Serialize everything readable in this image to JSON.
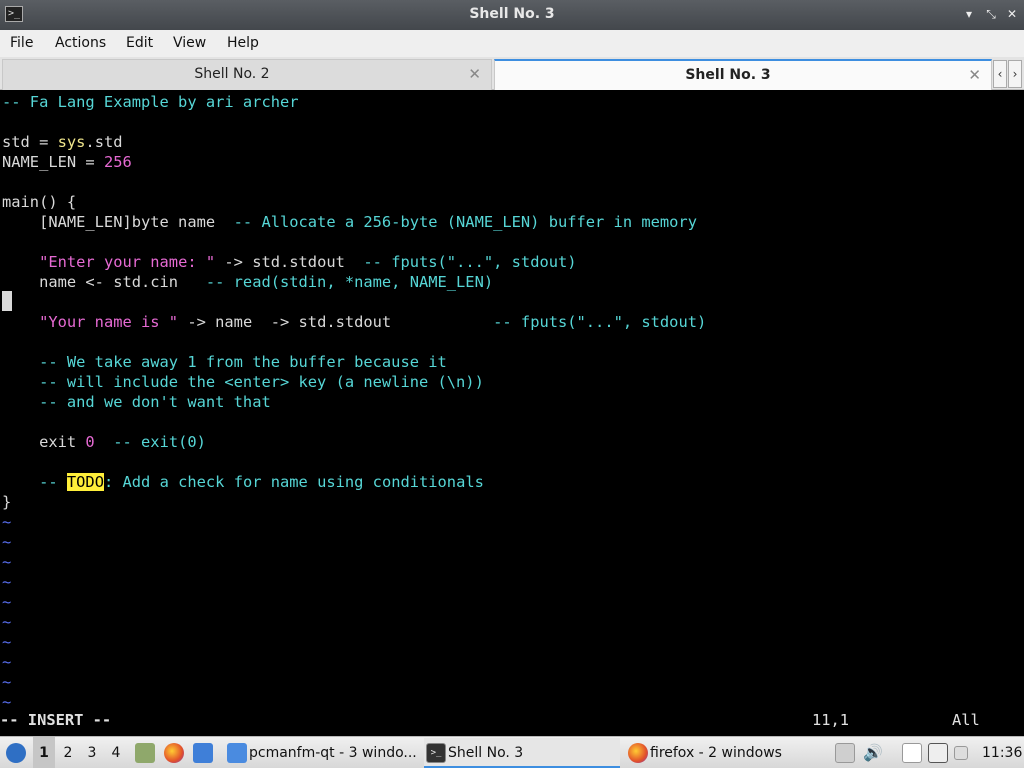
{
  "window": {
    "title": "Shell No. 3"
  },
  "menu": [
    "File",
    "Actions",
    "Edit",
    "View",
    "Help"
  ],
  "tabs": [
    {
      "label": "Shell No. 2",
      "active": false
    },
    {
      "label": "Shell No. 3",
      "active": true
    }
  ],
  "editor": {
    "lines": [
      "-- Fa Lang Example by ari archer",
      "",
      "std = sys.std",
      "NAME_LEN = 256",
      "",
      "main() {",
      "    [NAME_LEN]byte name  -- Allocate a 256-byte (NAME_LEN) buffer in memory",
      "",
      "    \"Enter your name: \" -> std.stdout  -- fputs(\"...\", stdout)",
      "    name <- std.cin   -- read(stdin, *name, NAME_LEN)",
      "",
      "    \"Your name is \" -> name  -> std.stdout           -- fputs(\"...\", stdout)",
      "",
      "    -- We take away 1 from the buffer because it",
      "    -- will include the <enter> key (a newline (\\n))",
      "    -- and we don't want that",
      "",
      "    exit 0  -- exit(0)",
      "",
      "    -- TODO: Add a check for name using conditionals",
      "}"
    ],
    "mode": "-- INSERT --",
    "position": "11,1",
    "scroll": "All"
  },
  "taskbar": {
    "desktops": [
      "1",
      "2",
      "3",
      "4"
    ],
    "active_desktop": "1",
    "tasks": [
      {
        "label": "pcmanfm-qt - 3 windo...",
        "icon": "folder-icon"
      },
      {
        "label": "Shell No. 3",
        "icon": "terminal-icon",
        "active": true
      },
      {
        "label": "firefox - 2 windows",
        "icon": "firefox-icon"
      }
    ],
    "clock": "11:36"
  },
  "colors": {
    "comment": "#56d6d6",
    "string": "#e66ad3",
    "keyword": "#f0e68c",
    "todo_bg": "#ffef3a",
    "tilde": "#5a6ff0",
    "accent": "#3d8ee0"
  }
}
